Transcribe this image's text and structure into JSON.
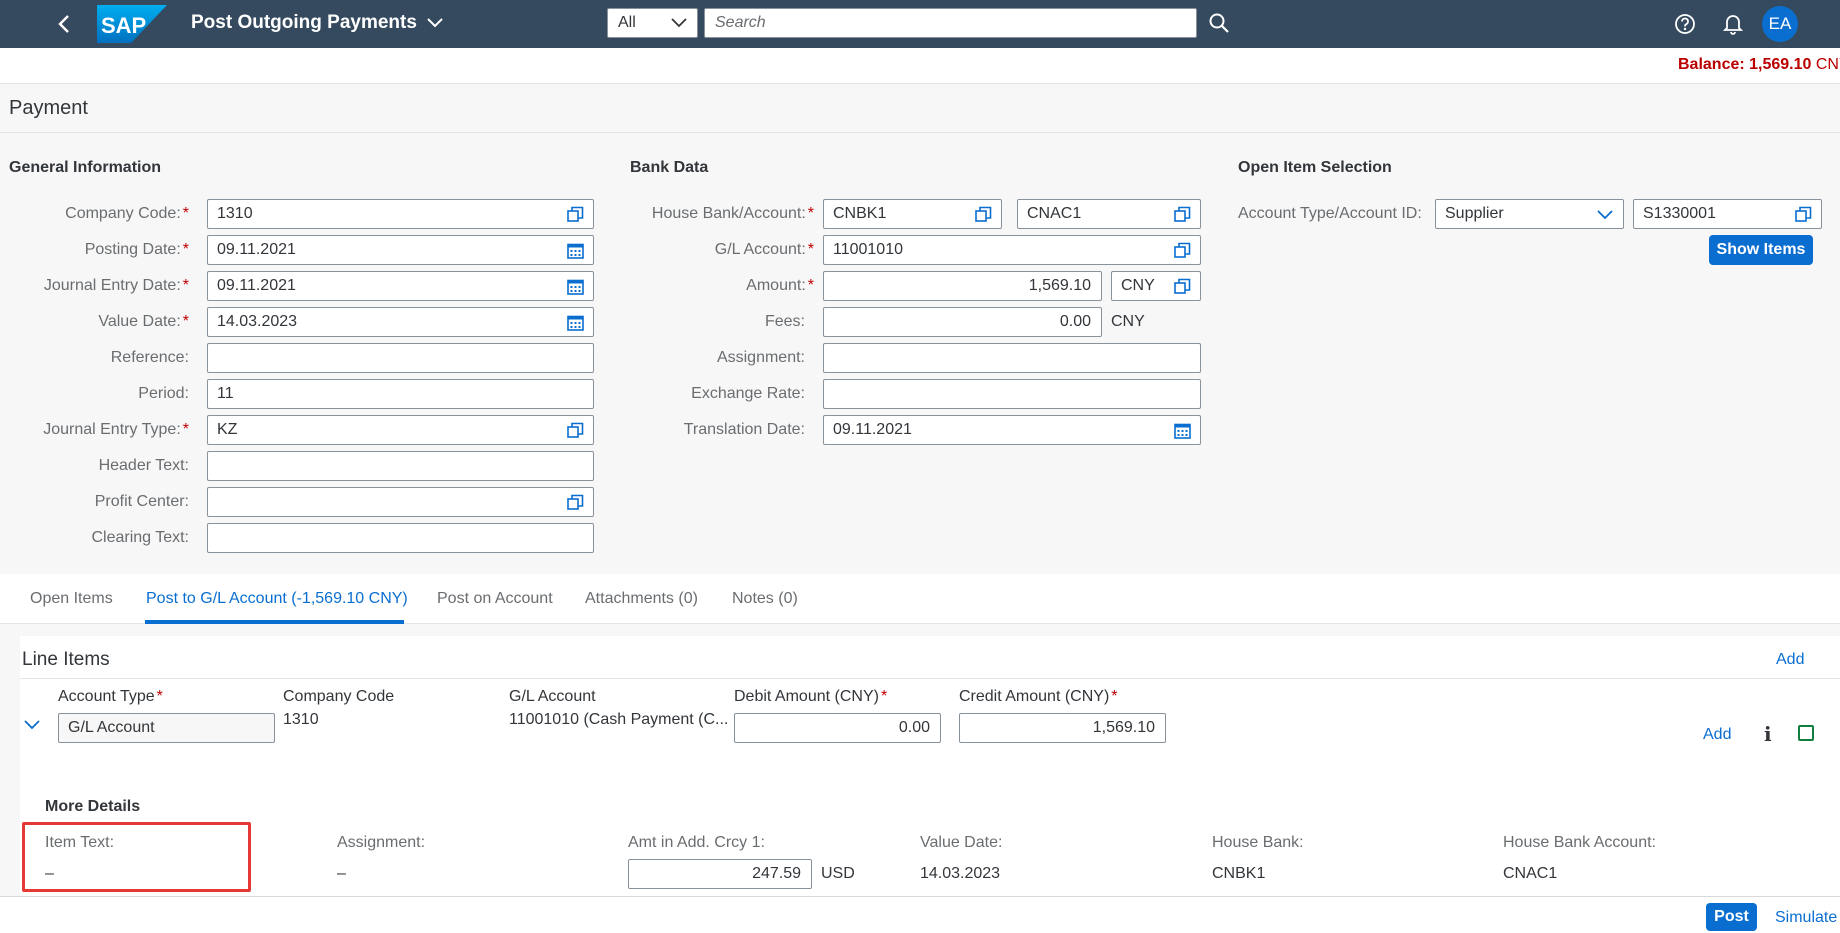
{
  "shell": {
    "title": "Post Outgoing Payments",
    "logo_text": "SAP",
    "search_scope": "All",
    "search_placeholder": "Search",
    "avatar_initials": "EA"
  },
  "balance": {
    "label": "Balance: 1,569.10",
    "currency": "CNY"
  },
  "page_title": "Payment",
  "general": {
    "title": "General Information",
    "fields": {
      "company_code": {
        "label": "Company Code:",
        "value": "1310"
      },
      "posting_date": {
        "label": "Posting Date:",
        "value": "09.11.2021"
      },
      "journal_entry_date": {
        "label": "Journal Entry Date:",
        "value": "09.11.2021"
      },
      "value_date": {
        "label": "Value Date:",
        "value": "14.03.2023"
      },
      "reference": {
        "label": "Reference:",
        "value": ""
      },
      "period": {
        "label": "Period:",
        "value": "11"
      },
      "journal_entry_type": {
        "label": "Journal Entry Type:",
        "value": "KZ"
      },
      "header_text": {
        "label": "Header Text:",
        "value": ""
      },
      "profit_center": {
        "label": "Profit Center:",
        "value": ""
      },
      "clearing_text": {
        "label": "Clearing Text:",
        "value": ""
      }
    }
  },
  "bank": {
    "title": "Bank Data",
    "fields": {
      "house_bank": {
        "label": "House Bank/Account:",
        "bank": "CNBK1",
        "account": "CNAC1"
      },
      "gl_account": {
        "label": "G/L Account:",
        "value": "11001010"
      },
      "amount": {
        "label": "Amount:",
        "value": "1,569.10",
        "currency": "CNY"
      },
      "fees": {
        "label": "Fees:",
        "value": "0.00",
        "currency": "CNY"
      },
      "assignment": {
        "label": "Assignment:",
        "value": ""
      },
      "exchange_rate": {
        "label": "Exchange Rate:",
        "value": ""
      },
      "translation_date": {
        "label": "Translation Date:",
        "value": "09.11.2021"
      }
    }
  },
  "open_item": {
    "title": "Open Item Selection",
    "account_label": "Account Type/Account ID:",
    "account_type": "Supplier",
    "account_id": "S1330001",
    "show_items": "Show Items"
  },
  "tabs": [
    {
      "label": "Open Items"
    },
    {
      "label": "Post to G/L Account (-1,569.10 CNY)"
    },
    {
      "label": "Post on Account"
    },
    {
      "label": "Attachments (0)"
    },
    {
      "label": "Notes (0)"
    }
  ],
  "line_items": {
    "title": "Line Items",
    "add": "Add",
    "columns": {
      "account_type": "Account Type",
      "company_code": "Company Code",
      "gl_account": "G/L Account",
      "debit": "Debit Amount (CNY)",
      "credit": "Credit Amount (CNY)"
    },
    "row": {
      "account_type": "G/L Account",
      "company_code": "1310",
      "gl_account": "11001010 (Cash Payment (C...",
      "debit": "0.00",
      "credit": "1,569.10",
      "add": "Add",
      "info": "i"
    },
    "more_details": {
      "title": "More Details",
      "item_text": {
        "label": "Item Text:",
        "value": "–"
      },
      "assignment": {
        "label": "Assignment:",
        "value": "–"
      },
      "amt_add_crcy": {
        "label": "Amt in Add. Crcy 1:",
        "value": "247.59",
        "currency": "USD"
      },
      "value_date": {
        "label": "Value Date:",
        "value": "14.03.2023"
      },
      "house_bank": {
        "label": "House Bank:",
        "value": "CNBK1"
      },
      "house_bank_account": {
        "label": "House Bank Account:",
        "value": "CNAC1"
      }
    }
  },
  "footer": {
    "post": "Post",
    "simulate": "Simulate"
  },
  "colors": {
    "shell": "#354a5f",
    "accent": "#0a6ed1",
    "error": "#bb0000",
    "highlight": "#e53935"
  }
}
